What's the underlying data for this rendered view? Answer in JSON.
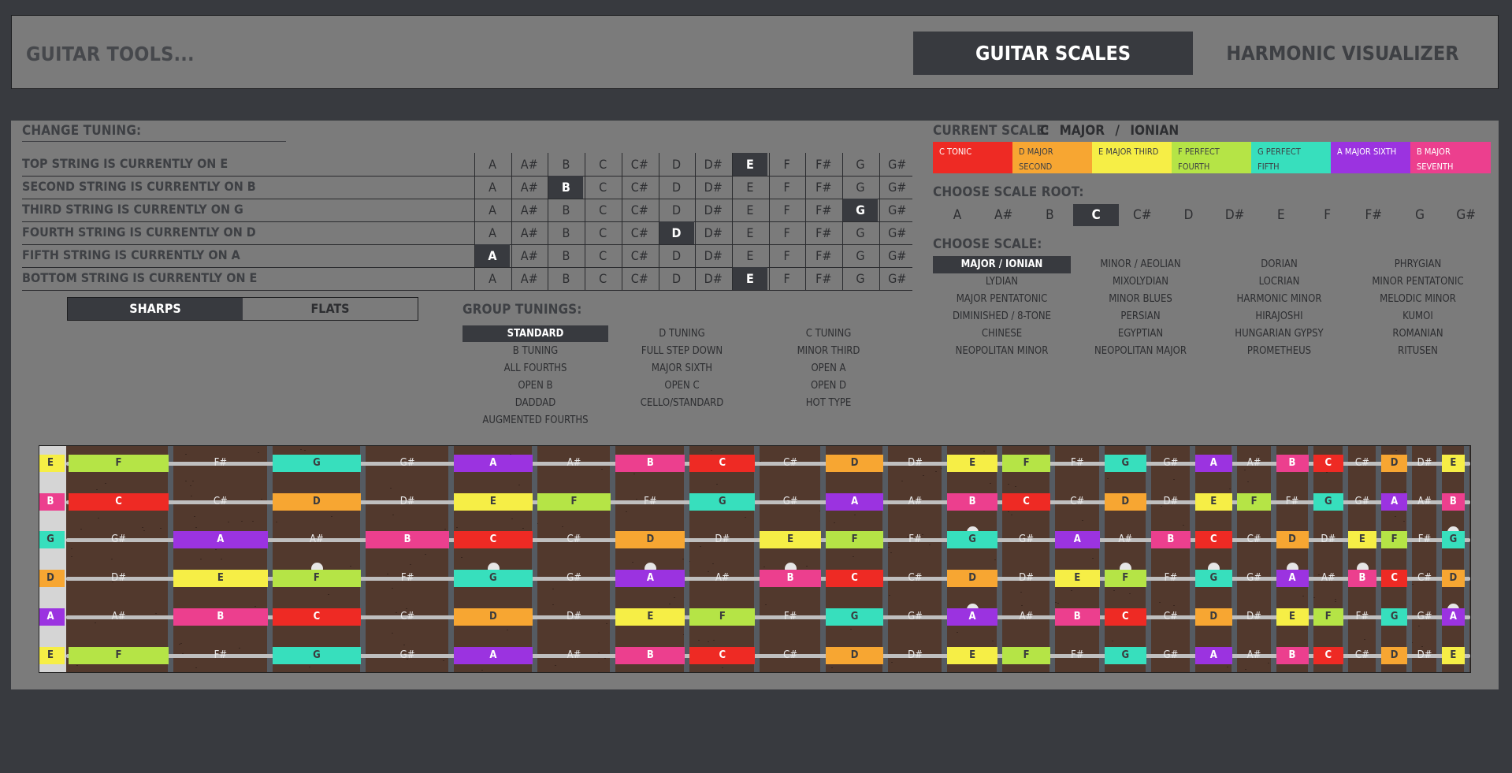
{
  "header": {
    "brand": "GUITAR TOOLS...",
    "tabs": [
      {
        "label": "GUITAR SCALES",
        "active": true
      },
      {
        "label": "HARMONIC VISUALIZER",
        "active": false
      }
    ]
  },
  "tuning": {
    "title": "CHANGE TUNING:",
    "notes": [
      "A",
      "A#",
      "B",
      "C",
      "C#",
      "D",
      "D#",
      "E",
      "F",
      "F#",
      "G",
      "G#"
    ],
    "strings": [
      {
        "label": "TOP STRING IS CURRENTLY ON E",
        "selected": "E"
      },
      {
        "label": "SECOND STRING IS CURRENTLY ON B",
        "selected": "B"
      },
      {
        "label": "THIRD STRING IS CURRENTLY ON G",
        "selected": "G"
      },
      {
        "label": "FOURTH STRING IS CURRENTLY ON D",
        "selected": "D"
      },
      {
        "label": "FIFTH STRING IS CURRENTLY ON A",
        "selected": "A"
      },
      {
        "label": "BOTTOM STRING IS CURRENTLY ON E",
        "selected": "E"
      }
    ]
  },
  "accidentals": {
    "sharps": "SHARPS",
    "flats": "FLATS",
    "selected": "sharps"
  },
  "group_tunings": {
    "title": "GROUP TUNINGS:",
    "columns": [
      [
        "STANDARD",
        "B TUNING",
        "ALL FOURTHS",
        "OPEN B",
        "DADDAD",
        "AUGMENTED FOURTHS"
      ],
      [
        "D TUNING",
        "FULL STEP DOWN",
        "MAJOR SIXTH",
        "OPEN C",
        "CELLO/STANDARD"
      ],
      [
        "C TUNING",
        "MINOR THIRD",
        "OPEN A",
        "OPEN D",
        "HOT TYPE"
      ]
    ],
    "selected": "STANDARD"
  },
  "current_scale": {
    "title": "CURRENT SCALE:",
    "root": "C",
    "name": "MAJOR / IONIAN",
    "legend": [
      {
        "label": "C TONIC",
        "color": "#ee2a24"
      },
      {
        "label": "D MAJOR SECOND",
        "color": "#f7a632"
      },
      {
        "label": "E MAJOR THIRD",
        "color": "#f6ee46"
      },
      {
        "label": "F PERFECT FOURTH",
        "color": "#b5e446"
      },
      {
        "label": "G PERFECT FIFTH",
        "color": "#37dfbd"
      },
      {
        "label": "A MAJOR SIXTH",
        "color": "#9b33e0"
      },
      {
        "label": "B MAJOR SEVENTH",
        "color": "#ec3f8e"
      }
    ]
  },
  "scale_root": {
    "title": "CHOOSE SCALE ROOT:",
    "notes": [
      "A",
      "A#",
      "B",
      "C",
      "C#",
      "D",
      "D#",
      "E",
      "F",
      "F#",
      "G",
      "G#"
    ],
    "selected": "C"
  },
  "scales": {
    "title": "CHOOSE SCALE:",
    "items": [
      "MAJOR / IONIAN",
      "MINOR / AEOLIAN",
      "DORIAN",
      "PHRYGIAN",
      "LYDIAN",
      "MIXOLYDIAN",
      "LOCRIAN",
      "MINOR PENTATONIC",
      "MAJOR PENTATONIC",
      "MINOR BLUES",
      "HARMONIC MINOR",
      "MELODIC MINOR",
      "DIMINISHED / 8-TONE",
      "PERSIAN",
      "HIRAJOSHI",
      "KUMOI",
      "CHINESE",
      "EGYPTIAN",
      "HUNGARIAN GYPSY",
      "ROMANIAN",
      "NEOPOLITAN MINOR",
      "NEOPOLITAN MAJOR",
      "PROMETHEUS",
      "RITUSEN"
    ],
    "selected": "MAJOR / IONIAN"
  },
  "fretboard": {
    "chromatic": [
      "A",
      "A#",
      "B",
      "C",
      "C#",
      "D",
      "D#",
      "E",
      "F",
      "F#",
      "G",
      "G#"
    ],
    "scale_notes": [
      "C",
      "D",
      "E",
      "F",
      "G",
      "A",
      "B"
    ],
    "frets": 24,
    "open_strings": [
      "E",
      "B",
      "G",
      "D",
      "A",
      "E"
    ],
    "inlay_frets_single": [
      3,
      5,
      7,
      9,
      15,
      17,
      19,
      21
    ],
    "inlay_frets_double": [
      12,
      24
    ]
  }
}
